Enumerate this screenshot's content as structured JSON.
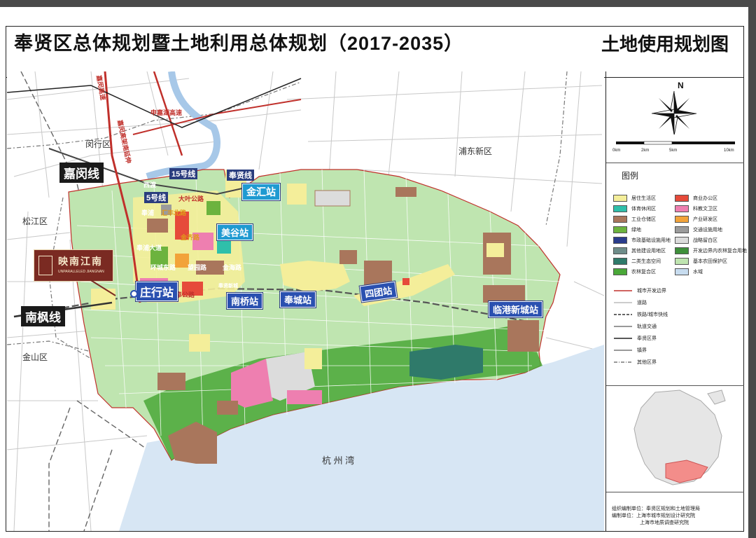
{
  "title": "奉贤区总体规划暨土地利用总体规划（2017-2035）",
  "subtitle": "土地使用规划图",
  "compass": {
    "north": "N"
  },
  "scale_bar": {
    "ticks": [
      "0km",
      "2km",
      "5km",
      "10km"
    ]
  },
  "legend": {
    "title": "图例",
    "landuse": [
      {
        "label": "居住生活区",
        "color": "#f4ee9a"
      },
      {
        "label": "商业办公区",
        "color": "#e64a3a"
      },
      {
        "label": "体育休闲区",
        "color": "#2fbfaa"
      },
      {
        "label": "科教文卫区",
        "color": "#ee7fb0"
      },
      {
        "label": "工业仓储区",
        "color": "#a9765c"
      },
      {
        "label": "产业研发区",
        "color": "#f2a33a"
      },
      {
        "label": "绿地",
        "color": "#6cb33e"
      },
      {
        "label": "交通设施用地",
        "color": "#9b9b9b"
      },
      {
        "label": "市政基础设施用地",
        "color": "#2a3c8c"
      },
      {
        "label": "战略留白区",
        "color": "#dcdcdc"
      },
      {
        "label": "其他建设用地区",
        "color": "#6f8d8a"
      },
      {
        "label": "开发边界内农林复合用地",
        "color": "#3e8f3a"
      },
      {
        "label": "二类生态空间",
        "color": "#2f7a6a"
      },
      {
        "label": "基本农田保护区",
        "color": "#bfe5b0"
      },
      {
        "label": "农林复合区",
        "color": "#4aa838"
      },
      {
        "label": "水域",
        "color": "#c7dcef"
      }
    ],
    "lines": [
      {
        "label": "城市开发边界"
      },
      {
        "label": "道路"
      },
      {
        "label": "铁路/城市快线"
      },
      {
        "label": "轨道交通"
      },
      {
        "label": "奉贤区界"
      },
      {
        "label": "镇界"
      },
      {
        "label": "其他区界"
      }
    ]
  },
  "credits": {
    "org": "组织编制单位：奉贤区规划和土地管理局",
    "maker1": "编制单位：上海市城市规划设计研究院",
    "maker2": "上海市地质调查研究院"
  },
  "map_labels": {
    "districts": [
      "闵行区",
      "浦东新区",
      "松江区",
      "金山区"
    ],
    "water": "杭  州  湾",
    "stations": [
      "金汇站",
      "美谷站",
      "庄行站",
      "南桥站",
      "奉城站",
      "四团站",
      "临港新城站"
    ],
    "line_tags": [
      "嘉闵线",
      "南枫线"
    ],
    "metro_lines": [
      "15号线",
      "5号线",
      "奉贤线"
    ],
    "roads": [
      "汇丰北路",
      "金齐路",
      "大叶公路",
      "奉浦大道",
      "环城东路",
      "望园路",
      "金海路",
      "南奉公路",
      "沪杭公路",
      "申嘉湖高速",
      "嘉闵高架",
      "西渡",
      "奉浦",
      "金海湖",
      "奉贤新城"
    ],
    "rotated": [
      "嘉闵高速",
      "嘉闵高架南延伸"
    ],
    "brand_cn": "映南江南",
    "brand_en": "UNPARALLELED JIANGNAN"
  }
}
